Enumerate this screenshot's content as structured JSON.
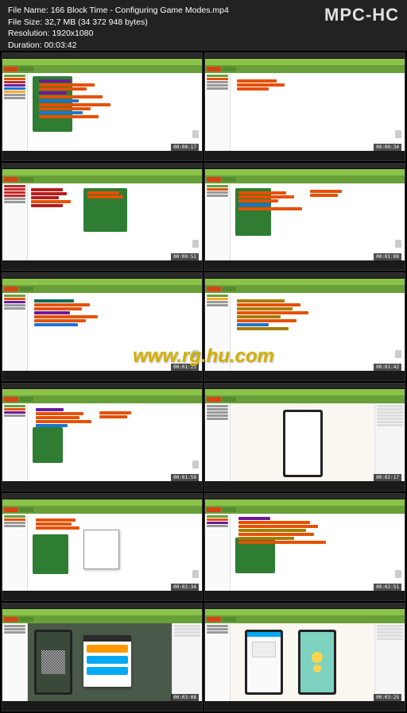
{
  "header": {
    "app_name": "MPC-HC",
    "filename_label": "File Name:",
    "filename": "166 Block Time - Configuring Game Modes.mp4",
    "filesize_label": "File Size:",
    "filesize": "32,7 MB (34 372 948 bytes)",
    "resolution_label": "Resolution:",
    "resolution": "1920x1080",
    "duration_label": "Duration:",
    "duration": "00:03:42"
  },
  "watermark": "www.rg.hu.com",
  "thumbnails": [
    {
      "timestamp": "00:00:17",
      "layout": "blocks_dense"
    },
    {
      "timestamp": "00:00:34",
      "layout": "blocks_sparse"
    },
    {
      "timestamp": "00:00:51",
      "layout": "blocks_red"
    },
    {
      "timestamp": "00:01:08",
      "layout": "blocks_green"
    },
    {
      "timestamp": "00:01:25",
      "layout": "blocks_mid"
    },
    {
      "timestamp": "00:01:42",
      "layout": "blocks_yellow"
    },
    {
      "timestamp": "00:01:59",
      "layout": "blocks_left"
    },
    {
      "timestamp": "00:02:17",
      "layout": "designer"
    },
    {
      "timestamp": "00:02:34",
      "layout": "blocks_context"
    },
    {
      "timestamp": "00:02:51",
      "layout": "blocks_wide"
    },
    {
      "timestamp": "00:03:08",
      "layout": "preview_qr"
    },
    {
      "timestamp": "00:03:25",
      "layout": "preview_app"
    }
  ]
}
